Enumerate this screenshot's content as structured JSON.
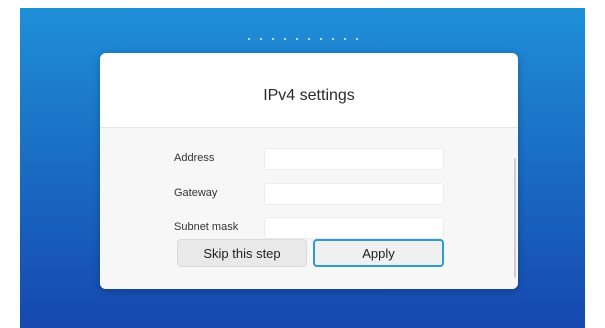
{
  "dialog": {
    "title": "IPv4 settings",
    "fields": [
      {
        "label": "Address",
        "value": "",
        "placeholder": ""
      },
      {
        "label": "Gateway",
        "value": "",
        "placeholder": ""
      },
      {
        "label": "Subnet mask",
        "value": "",
        "placeholder": ""
      }
    ],
    "buttons": {
      "skip_label": "Skip this step",
      "apply_label": "Apply"
    }
  },
  "progress": {
    "step_dots": 10
  },
  "colors": {
    "background_top": "#1f8fd8",
    "background_bottom": "#1648b0",
    "apply_border": "#2b9bd6"
  }
}
